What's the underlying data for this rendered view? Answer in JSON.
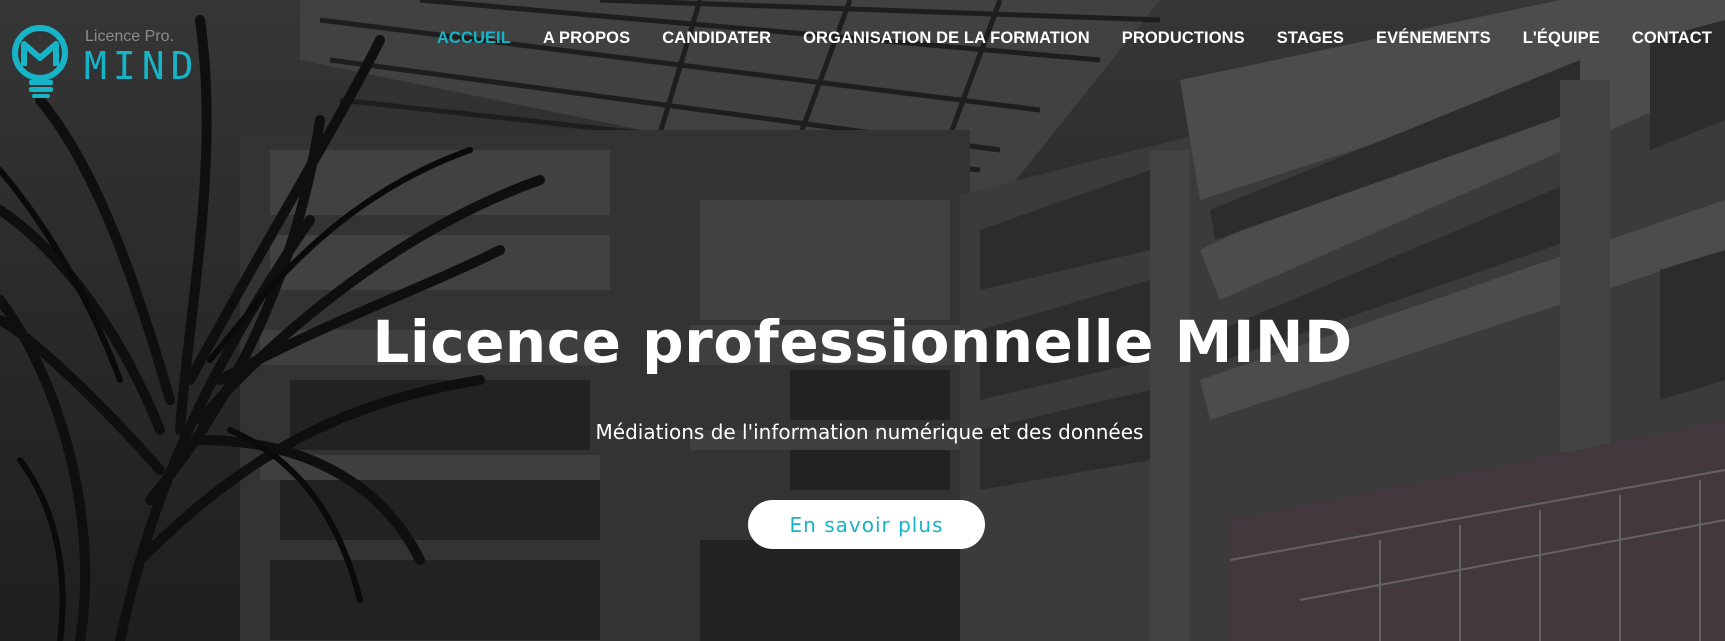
{
  "brand": {
    "logo_small_text": "Licence Pro.",
    "logo_big_text": "MIND",
    "accent_color": "#17b3c6"
  },
  "nav": {
    "items": [
      {
        "label": "ACCUEIL",
        "active": true
      },
      {
        "label": "A PROPOS",
        "active": false
      },
      {
        "label": "CANDIDATER",
        "active": false
      },
      {
        "label": "ORGANISATION DE LA FORMATION",
        "active": false
      },
      {
        "label": "PRODUCTIONS",
        "active": false
      },
      {
        "label": "STAGES",
        "active": false
      },
      {
        "label": "EVÉNEMENTS",
        "active": false
      },
      {
        "label": "L'ÉQUIPE",
        "active": false
      },
      {
        "label": "CONTACT",
        "active": false
      }
    ]
  },
  "hero": {
    "title": "Licence professionnelle MIND",
    "subtitle": "Médiations de l'information numérique et des données",
    "cta_label": "En savoir plus"
  }
}
